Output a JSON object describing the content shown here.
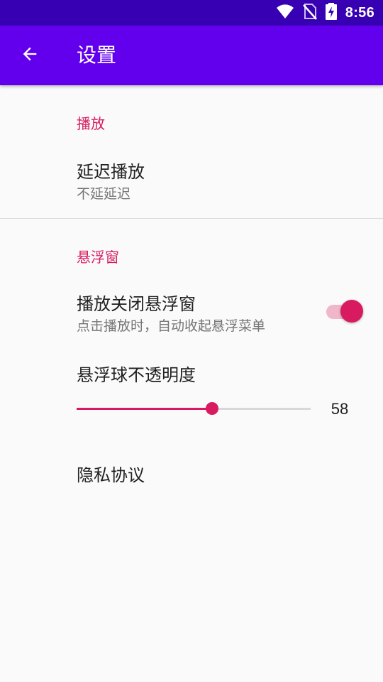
{
  "status_bar": {
    "time": "8:56",
    "icons": [
      "wifi-icon",
      "no-sim-icon",
      "battery-charging-icon"
    ]
  },
  "app_bar": {
    "title": "设置",
    "back_icon": "arrow-back-icon"
  },
  "sections": {
    "playback": {
      "title": "播放",
      "delay": {
        "title": "延迟播放",
        "summary": "不延延迟"
      }
    },
    "floating": {
      "title": "悬浮窗",
      "close_on_play": {
        "title": "播放关闭悬浮窗",
        "summary": "点击播放时，自动收起悬浮菜单",
        "enabled": true
      },
      "opacity": {
        "title": "悬浮球不透明度",
        "value": 58,
        "value_text": "58",
        "min": 0,
        "max": 100
      }
    },
    "privacy": {
      "title": "隐私协议"
    }
  },
  "colors": {
    "status_bar": "#3700b3",
    "app_bar": "#6200ee",
    "accent": "#d81b60",
    "switch_track": "#f0b6c9",
    "background": "#fafafa"
  }
}
